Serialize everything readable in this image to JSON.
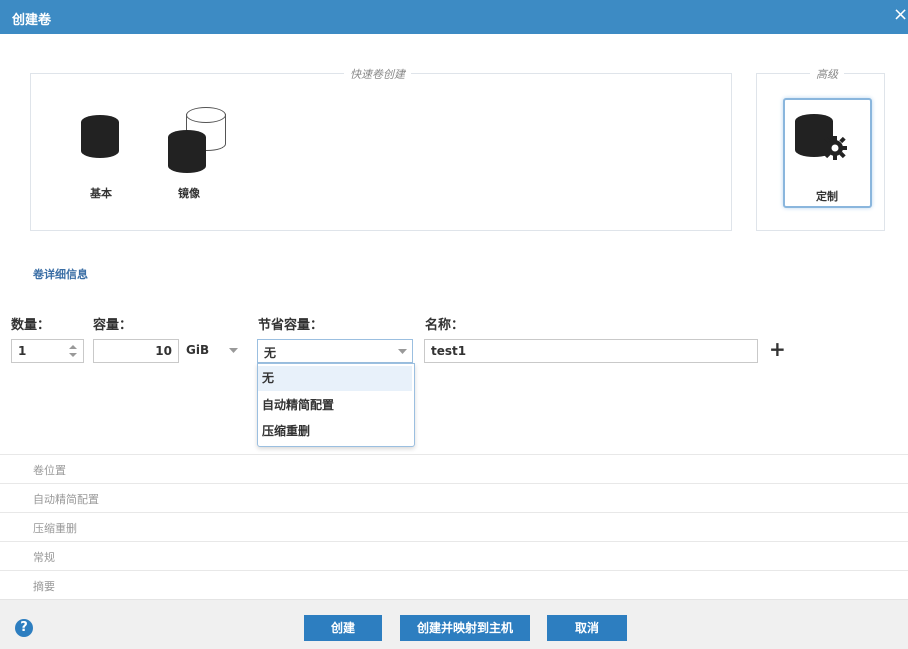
{
  "dialog": {
    "title": "创建卷",
    "close_glyph": "×"
  },
  "quick_create": {
    "legend": "快速卷创建",
    "options": [
      {
        "label": "基本",
        "icon": "single-disk-icon"
      },
      {
        "label": "镜像",
        "icon": "mirror-disk-icon"
      }
    ]
  },
  "advanced": {
    "legend": "高级",
    "custom_label": "定制",
    "icon": "disk-gear-icon"
  },
  "details": {
    "section_title": "卷详细信息",
    "quantity": {
      "label": "数量：",
      "value": "1"
    },
    "capacity": {
      "label": "容量：",
      "value": "10",
      "unit": "GiB"
    },
    "savings": {
      "label": "节省容量：",
      "value": "无",
      "options": [
        "无",
        "自动精简配置",
        "压缩重删"
      ],
      "selected_index": 0
    },
    "name": {
      "label": "名称：",
      "value": "test1"
    },
    "add_glyph": "+"
  },
  "sections": [
    "卷位置",
    "自动精简配置",
    "压缩重删",
    "常规",
    "摘要"
  ],
  "footer": {
    "help_glyph": "?",
    "buttons": {
      "create": "创建",
      "create_map": "创建并映射到主机",
      "cancel": "取消"
    }
  },
  "colors": {
    "header": "#3d8bc4",
    "button": "#2d7ec0",
    "link": "#3a6ea5"
  }
}
